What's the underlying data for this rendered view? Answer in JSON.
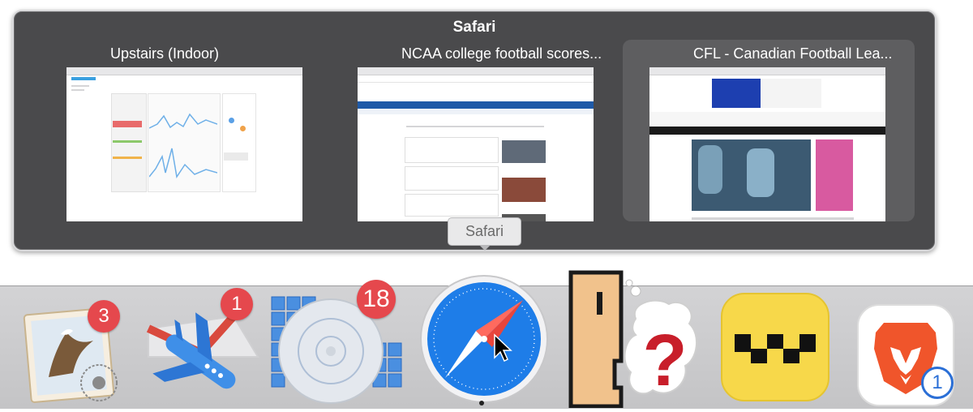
{
  "expose": {
    "app_title": "Safari",
    "windows": [
      {
        "label": "Upstairs (Indoor)"
      },
      {
        "label": "NCAA college football scores..."
      },
      {
        "label": "CFL - Canadian Football Lea..."
      }
    ]
  },
  "tooltip": {
    "label": "Safari"
  },
  "dock": {
    "items": [
      {
        "name": "Mail",
        "badge": "3",
        "icon": "mail-eagle-icon"
      },
      {
        "name": "Airmail",
        "badge": "1",
        "icon": "airplane-icon"
      },
      {
        "name": "Calendar grid app",
        "badge": "18",
        "icon": "disk-grid-icon"
      },
      {
        "name": "Safari",
        "icon": "safari-compass-icon"
      },
      {
        "name": "Help Puzzle",
        "icon": "question-face-icon"
      },
      {
        "name": "Taxi",
        "icon": "taxi-icon"
      },
      {
        "name": "Brave",
        "badge": "1",
        "icon": "brave-lion-icon"
      }
    ]
  },
  "colors": {
    "badge_red": "#e5484d",
    "safari_blue": "#1e7de8",
    "dock_bg": "#cbcbcd"
  }
}
